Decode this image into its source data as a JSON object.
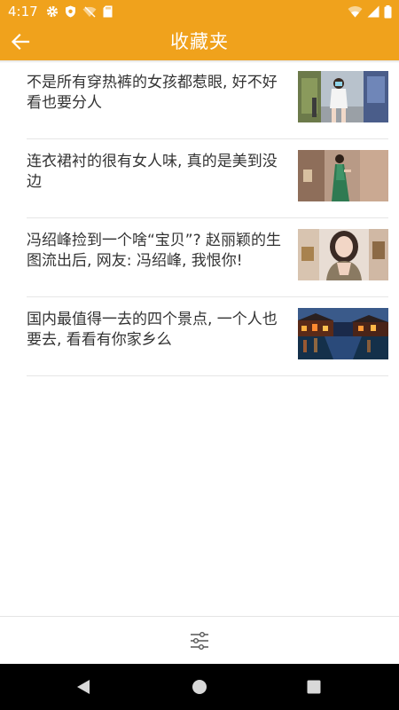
{
  "status_bar": {
    "time": "4:17",
    "left_icons": [
      "gear-icon",
      "shield-icon",
      "wifi-off-icon",
      "sd-card-icon"
    ],
    "right_icons": [
      "wifi-icon",
      "signal-icon",
      "battery-icon"
    ]
  },
  "app_bar": {
    "title": "收藏夹",
    "back_icon": "arrow-left-icon",
    "color": "#f0a21c"
  },
  "articles": [
    {
      "title": "不是所有穿热裤的女孩都惹眼, 好不好看也要分人",
      "thumbnail": "street-fashion-photo"
    },
    {
      "title": "连衣裙衬的很有女人味, 真的是美到没边",
      "thumbnail": "green-dress-photo"
    },
    {
      "title": "冯绍峰捡到一个啥“宝贝”? 赵丽颖的生图流出后, 网友: 冯绍峰, 我恨你!",
      "thumbnail": "portrait-photo"
    },
    {
      "title": "国内最值得一去的四个景点, 一个人也要去, 看看有你家乡么",
      "thumbnail": "water-town-night-photo"
    }
  ],
  "bottom_toolbar": {
    "icon": "sliders-icon"
  },
  "nav_bar": {
    "buttons": [
      "back-triangle-icon",
      "home-circle-icon",
      "recents-square-icon"
    ]
  }
}
